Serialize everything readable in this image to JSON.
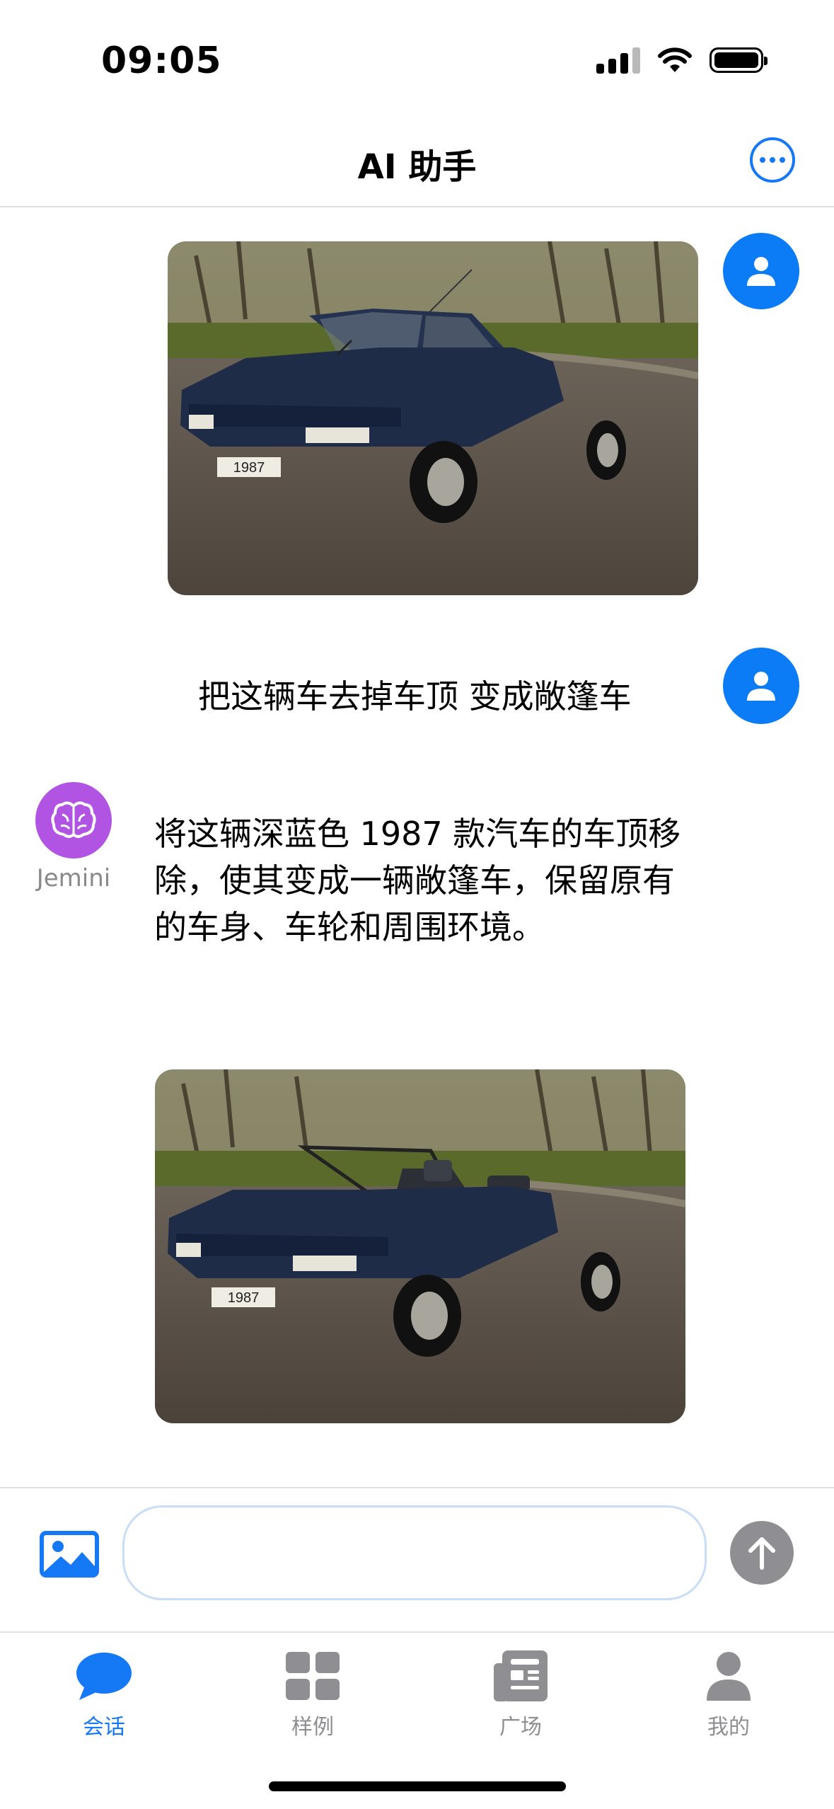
{
  "status_bar": {
    "time": "09:05"
  },
  "header": {
    "title": "AI 助手"
  },
  "chat": {
    "user_image_1": {
      "plate": "1987"
    },
    "user_message": "把这辆车去掉车顶 变成敞篷车",
    "bot": {
      "name": "Jemini",
      "message": "将这辆深蓝色 1987 款汽车的车顶移除，使其变成一辆敞篷车，保留原有的车身、车轮和周围环境。",
      "image_plate": "1987"
    }
  },
  "input": {
    "placeholder": "",
    "value": ""
  },
  "tabs": [
    {
      "label": "会话",
      "icon": "chat-bubble-icon",
      "active": true
    },
    {
      "label": "样例",
      "icon": "grid-icon",
      "active": false
    },
    {
      "label": "广场",
      "icon": "newspaper-icon",
      "active": false
    },
    {
      "label": "我的",
      "icon": "person-icon",
      "active": false
    }
  ],
  "colors": {
    "accent": "#1579f5",
    "bot_avatar": "#b154e3",
    "send_disabled": "#8e8e93",
    "car_body": "#1e2c48"
  }
}
